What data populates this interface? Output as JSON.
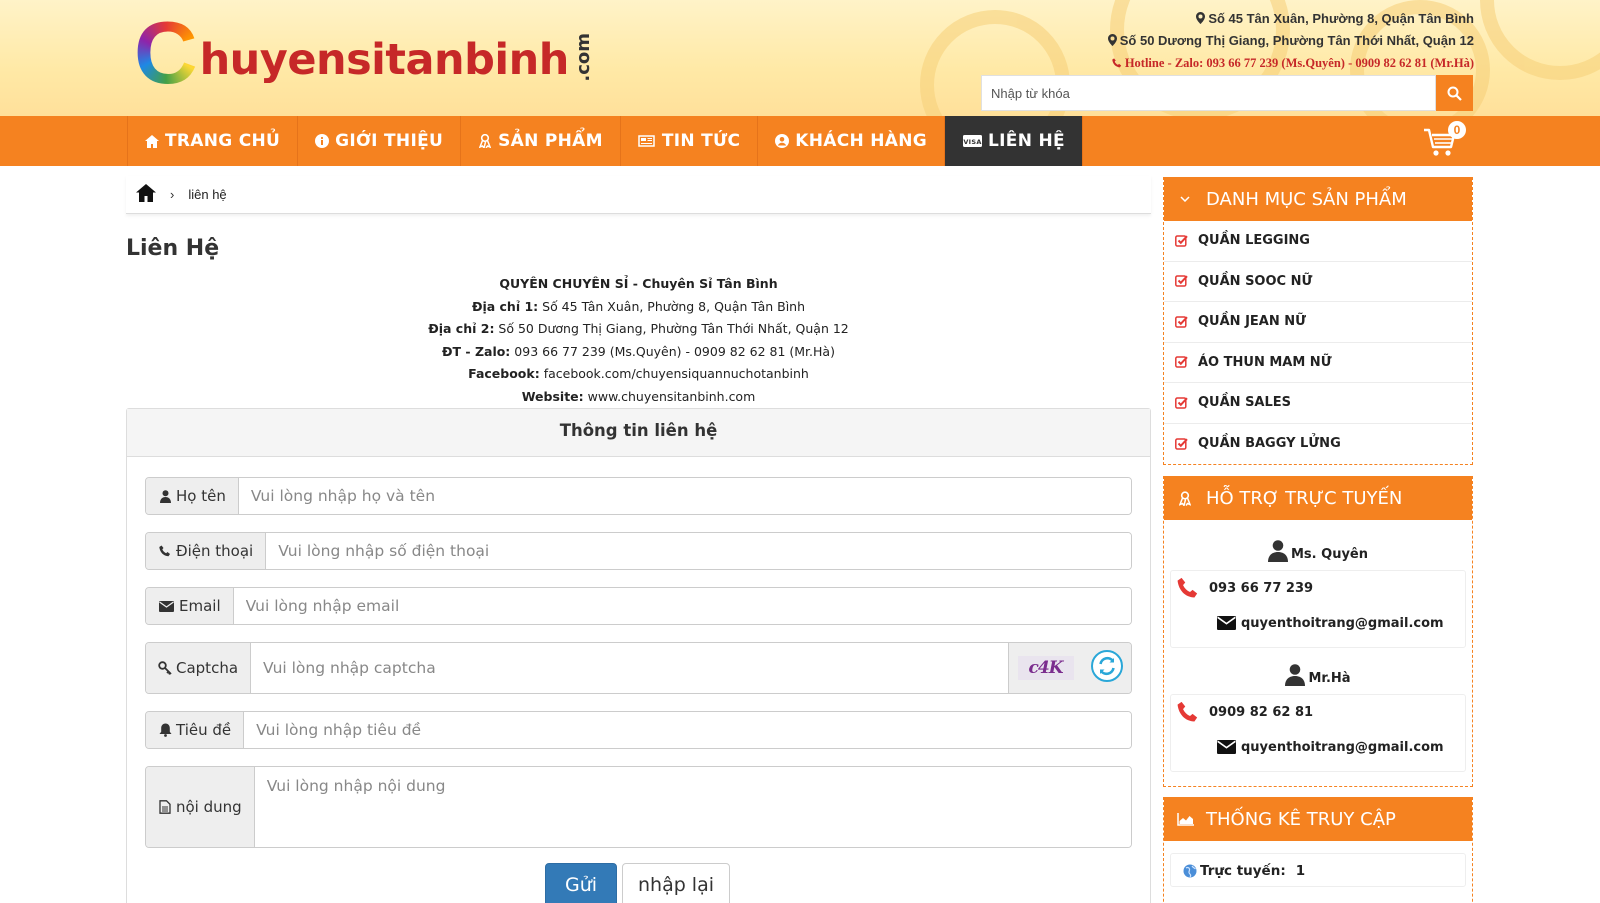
{
  "brand": {
    "logo_letter": "C",
    "logo_text": "huyensitanbinh",
    "logo_suffix": ".com"
  },
  "header": {
    "address1": "Số 45 Tân Xuân, Phường 8, Quận Tân Bình",
    "address2": "Số 50 Dương Thị Giang, Phường Tân Thới Nhất, Quận 12",
    "hotline": "Hotline - Zalo: 093 66 77 239 (Ms.Quyên) - 0909 82 62 81 (Mr.Hà)",
    "search_placeholder": "Nhập từ khóa"
  },
  "nav": {
    "items": [
      {
        "label": "TRANG CHỦ",
        "icon": "home-icon"
      },
      {
        "label": "GIỚI THIỆU",
        "icon": "info-icon"
      },
      {
        "label": "SẢN PHẨM",
        "icon": "ribbon-icon"
      },
      {
        "label": "TIN TỨC",
        "icon": "newspaper-icon"
      },
      {
        "label": "KHÁCH HÀNG",
        "icon": "user-circle-icon"
      },
      {
        "label": "LIÊN HỆ",
        "icon": "visa-card-icon",
        "active": true
      }
    ],
    "cart_count": "0"
  },
  "breadcrumb": {
    "current": "liên hệ"
  },
  "page": {
    "title": "Liên Hệ",
    "company": "QUYÊN CHUYÊN SỈ - Chuyên Sỉ Tân Bình",
    "addr1_label": "Địa chỉ 1:",
    "addr1_value": " Số 45 Tân Xuân, Phường 8, Quận Tân Bình",
    "addr2_label": "Địa chỉ 2:",
    "addr2_value": " Số 50 Dương Thị Giang, Phường Tân Thới Nhất, Quận 12",
    "phone_label": "ĐT - Zalo:",
    "phone_value": " 093 66 77 239 (Ms.Quyên) - 0909 82 62 81 (Mr.Hà)",
    "facebook_label": "Facebook:",
    "facebook_value": " facebook.com/chuyensiquannuchotanbinh",
    "website_label": "Website:",
    "website_value": " www.chuyensitanbinh.com"
  },
  "form": {
    "heading": "Thông tin liên hệ",
    "name_label": "Họ tên",
    "name_placeholder": "Vui lòng nhập họ và tên",
    "phone_label": "Điện thoại",
    "phone_placeholder": "Vui lòng nhập số điện thoại",
    "email_label": "Email",
    "email_placeholder": "Vui lòng nhập email",
    "captcha_label": "Captcha",
    "captcha_placeholder": "Vui lòng nhập captcha",
    "captcha_text": "c4K",
    "subject_label": "Tiêu đề",
    "subject_placeholder": "Vui lòng nhập tiêu đề",
    "content_label": "nội dung",
    "content_placeholder": "Vui lòng nhập nội dung",
    "submit": "Gửi",
    "reset": "nhập lại"
  },
  "sidebar": {
    "categories_title": "DANH MỤC SẢN PHẨM",
    "categories": [
      "QUẦN LEGGING",
      "QUẦN SOOC NỮ",
      "QUẦN JEAN NỮ",
      "ÁO THUN MAM NỮ",
      "QUẦN SALES",
      "QUẦN BAGGY LỬNG"
    ],
    "support_title": "HỖ TRỢ TRỰC TUYẾN",
    "supporters": [
      {
        "name": "Ms. Quyên",
        "phone": "093 66 77 239",
        "email": "quyenthoitrang@gmail.com"
      },
      {
        "name": "Mr.Hà",
        "phone": "0909 82 62 81",
        "email": "quyenthoitrang@gmail.com"
      }
    ],
    "stats_title": "THỐNG KÊ TRUY CẬP",
    "online_label": "Trực tuyến:",
    "online_value": "1"
  },
  "colors": {
    "accent": "#f58220",
    "nav_active": "#333333",
    "brand_red": "#c62828",
    "button_primary": "#337ab7"
  }
}
